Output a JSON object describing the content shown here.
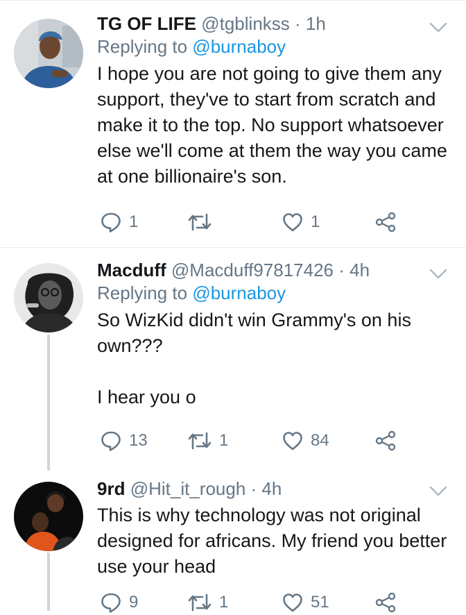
{
  "tweets": [
    {
      "name": "TG OF LIFE",
      "handle": "@tgblinkss",
      "time": "1h",
      "replying_label": "Replying to",
      "replying_to": "@burnaboy",
      "text": "I hope you are not going to give them any support, they've to start from scratch and make it to the top. No support whatsoever else we'll come at them the way you came at one billionaire's son.",
      "replies": "1",
      "retweets": "",
      "likes": "1"
    },
    {
      "name": "Macduff",
      "handle": "@Macduff97817426",
      "time": "4h",
      "replying_label": "Replying to",
      "replying_to": "@burnaboy",
      "text": "So WizKid didn't win Grammy's on his own???\n\nI hear you o",
      "replies": "13",
      "retweets": "1",
      "likes": "84"
    },
    {
      "name": "9rd",
      "handle": "@Hit_it_rough",
      "time": "4h",
      "text": "This is why technology was not original designed for africans. My friend you better use your head",
      "replies": "9",
      "retweets": "1",
      "likes": "51"
    }
  ],
  "icons": {
    "reply": "reply-icon",
    "retweet": "retweet-icon",
    "like": "heart-icon",
    "share": "share-icon",
    "caret": "chevron-down-icon"
  },
  "colors": {
    "text": "#14171a",
    "muted": "#657786",
    "link": "#1b95e0",
    "divider": "#e6ecf0",
    "thread": "#ccd6dd"
  }
}
